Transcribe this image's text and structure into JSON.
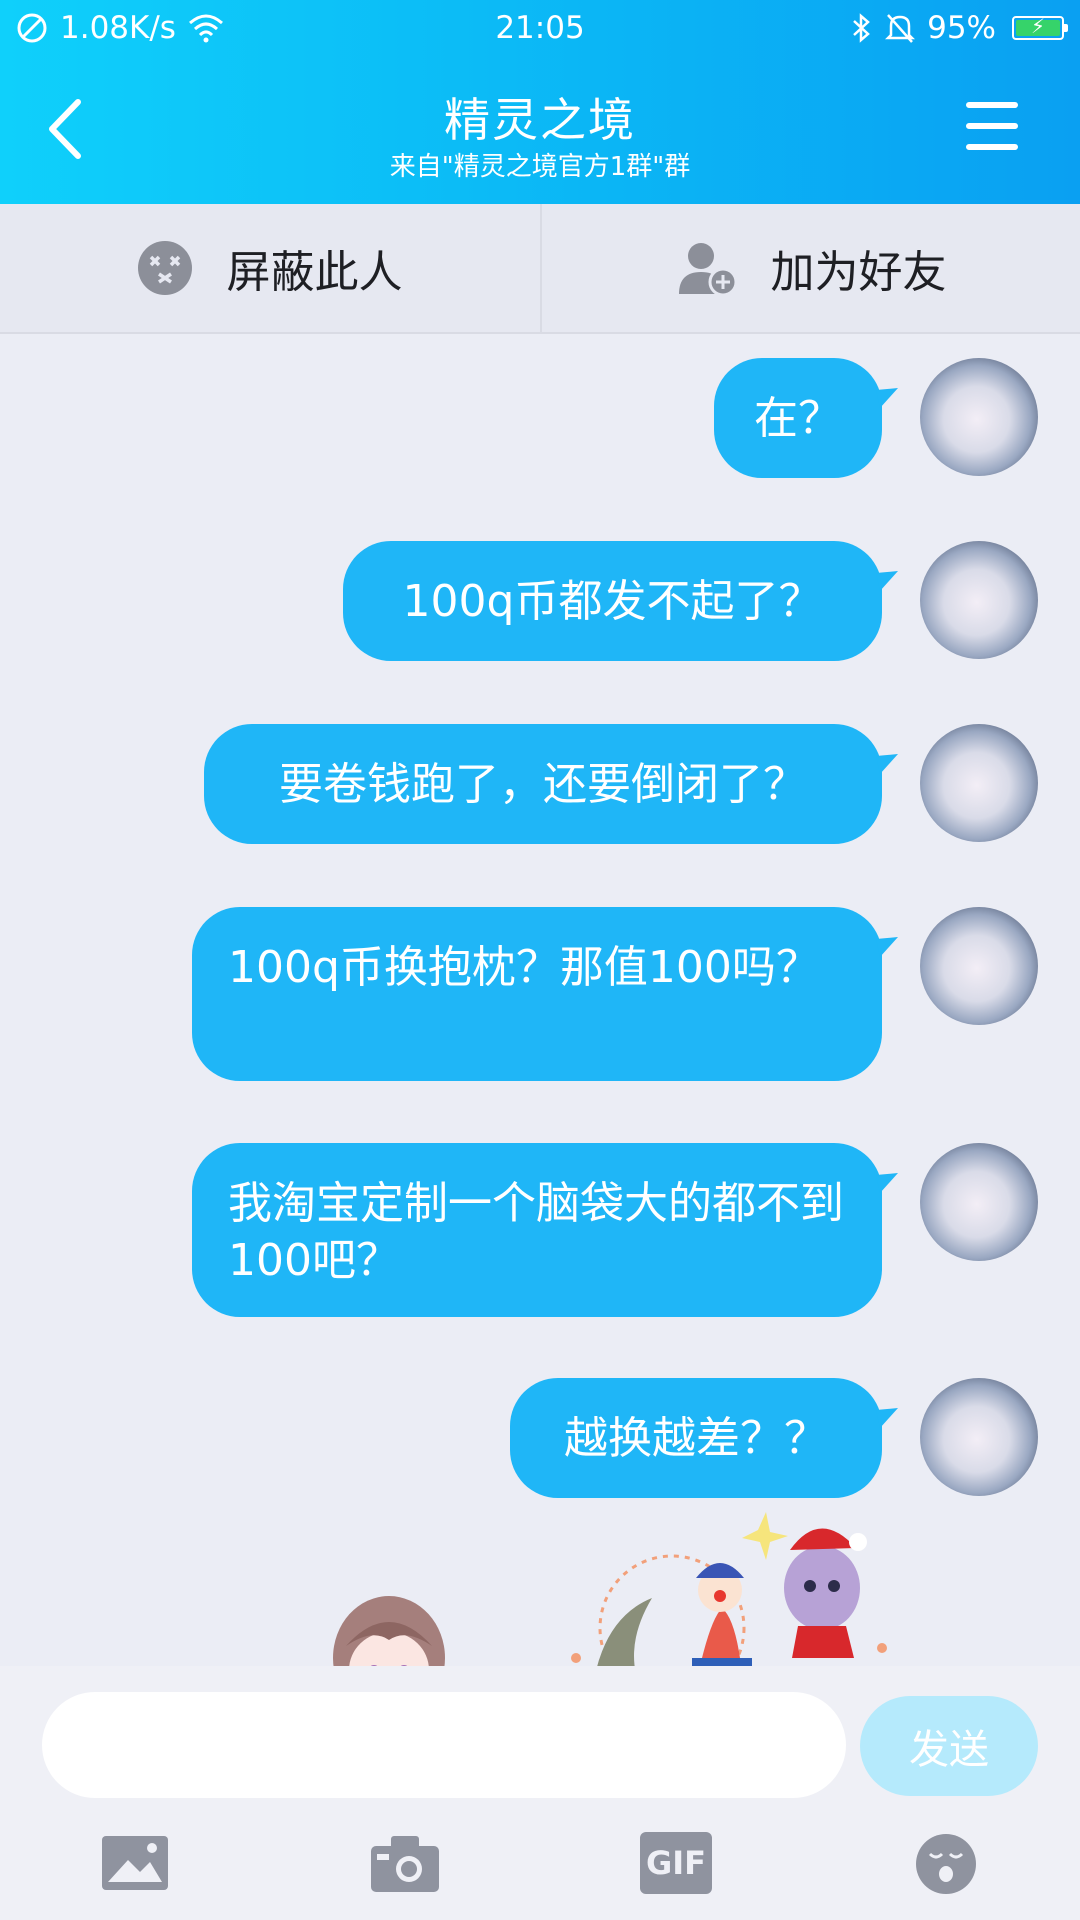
{
  "status_bar": {
    "network_speed": "1.08K/s",
    "time": "21:05",
    "battery": "95%",
    "icons": [
      "blocked-circle-icon",
      "wifi-icon",
      "bluetooth-icon",
      "bell-muted-icon",
      "battery-charging-icon"
    ]
  },
  "header": {
    "title": "精灵之境",
    "subtitle": "来自\"精灵之境官方1群\"群",
    "back_icon": "chevron-left-icon",
    "menu_icon": "menu-icon"
  },
  "actions": {
    "block": {
      "label": "屏蔽此人",
      "icon": "block-face-icon"
    },
    "add_friend": {
      "label": "加为好友",
      "icon": "add-friend-icon"
    }
  },
  "messages": [
    {
      "text": "在？",
      "sender": "self"
    },
    {
      "text": "100q币都发不起了？",
      "sender": "self"
    },
    {
      "text": "要卷钱跑了，还要倒闭了？",
      "sender": "self"
    },
    {
      "text": "100q币换抱枕？那值100吗？",
      "sender": "self"
    },
    {
      "text": "我淘宝定制一个脑袋大的都不到100吧？",
      "sender": "self"
    },
    {
      "text": "越换越差？？",
      "sender": "self"
    }
  ],
  "input": {
    "value": "",
    "placeholder": "",
    "send_label": "发送"
  },
  "toolbar": {
    "gif_label": "GIF",
    "icons": [
      "image-icon",
      "camera-icon",
      "gif-icon",
      "emoji-icon"
    ]
  },
  "colors": {
    "header_start": "#0fd0fb",
    "header_end": "#0aa0f2",
    "bubble": "#1fb6f7",
    "send_button": "#b5eafc",
    "background": "#ebedf5"
  }
}
